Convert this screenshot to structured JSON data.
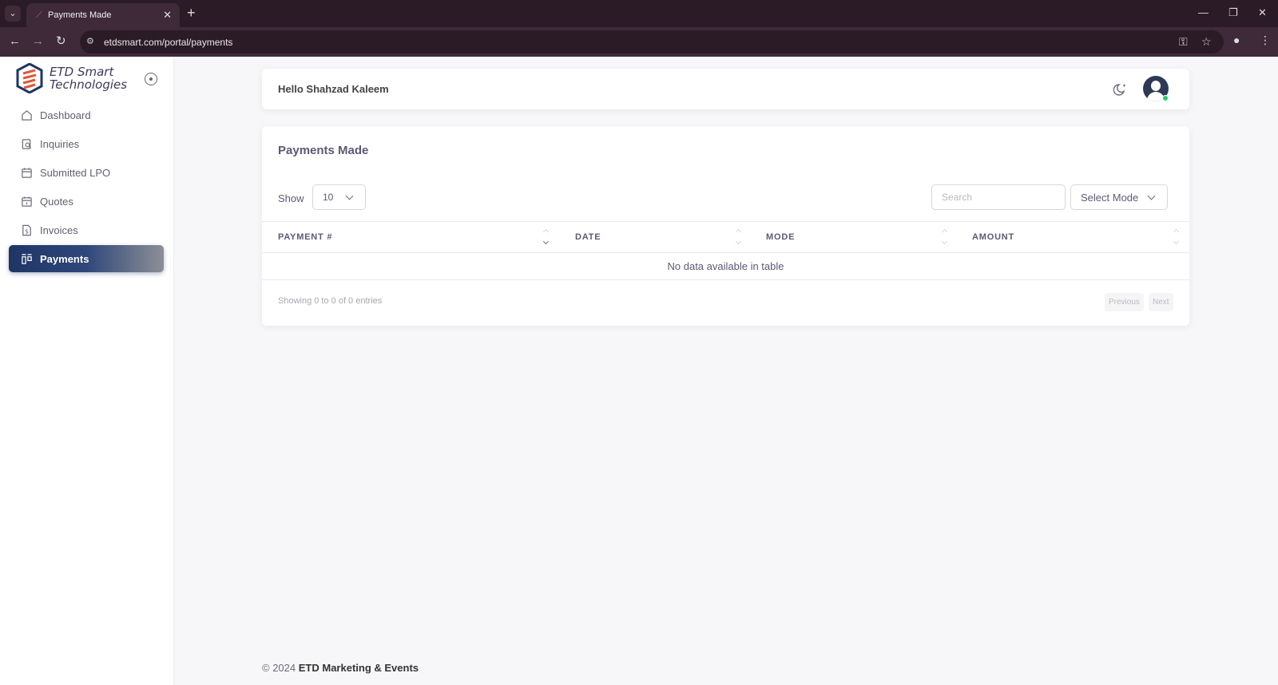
{
  "browser": {
    "tab_title": "Payments Made",
    "url": "etdsmart.com/portal/payments"
  },
  "brand": {
    "line1": "ETD Smart",
    "line2": "Technologies",
    "colors": {
      "navy": "#1f3566",
      "orange": "#e0593a"
    }
  },
  "sidebar": {
    "items": [
      {
        "label": "Dashboard",
        "icon": "home-icon",
        "active": false
      },
      {
        "label": "Inquiries",
        "icon": "inquiry-icon",
        "active": false
      },
      {
        "label": "Submitted LPO",
        "icon": "calendar-icon",
        "active": false
      },
      {
        "label": "Quotes",
        "icon": "calendar-icon",
        "active": false
      },
      {
        "label": "Invoices",
        "icon": "invoice-icon",
        "active": false
      },
      {
        "label": "Payments",
        "icon": "payments-icon",
        "active": true
      }
    ]
  },
  "header": {
    "greeting": "Hello Shahzad Kaleem"
  },
  "payments": {
    "title": "Payments Made",
    "show_label": "Show",
    "page_size": "10",
    "search_placeholder": "Search",
    "mode_select": "Select Mode",
    "columns": [
      "PAYMENT #",
      "DATE",
      "MODE",
      "AMOUNT"
    ],
    "empty_message": "No data available in table",
    "info": "Showing 0 to 0 of 0 entries",
    "prev_label": "Previous",
    "next_label": "Next"
  },
  "footer": {
    "prefix": "© 2024",
    "company": "ETD Marketing & Events"
  }
}
